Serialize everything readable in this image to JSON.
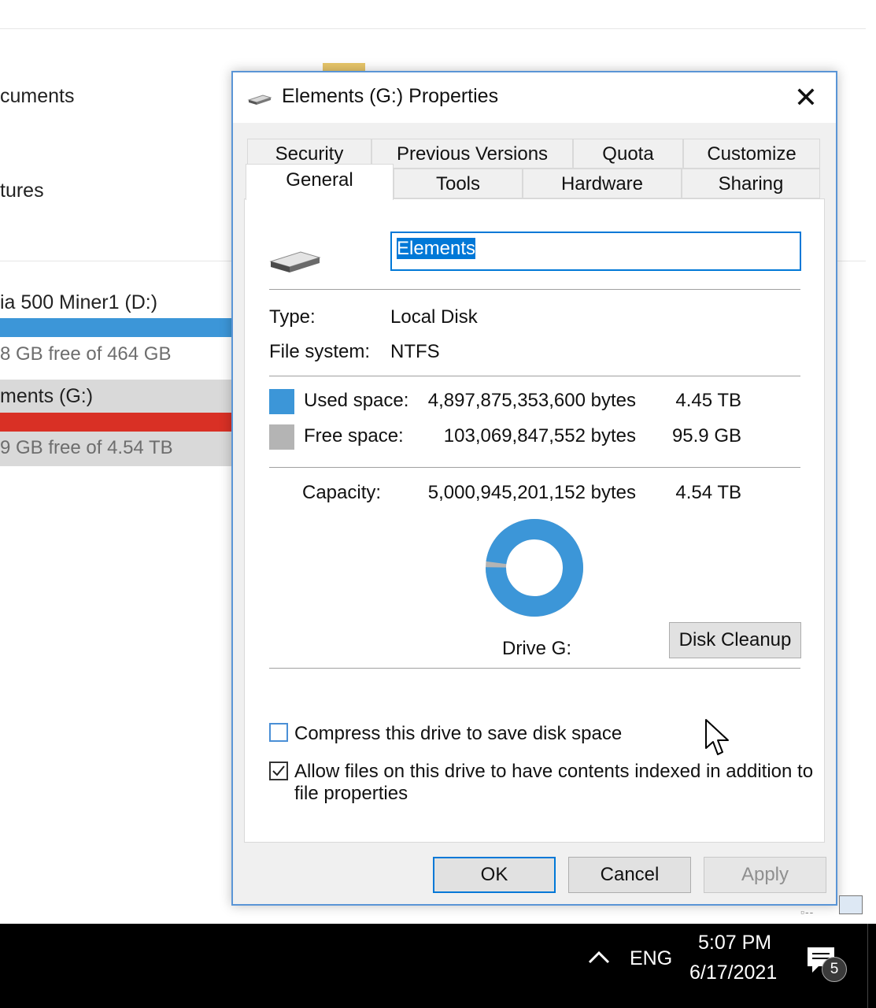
{
  "background": {
    "items": [
      "cuments",
      "tures"
    ],
    "drives": [
      {
        "name": "ia 500 Miner1 (D:)",
        "free": "8 GB free of 464 GB",
        "bar_color": "#3c96d8"
      },
      {
        "name": "ments (G:)",
        "free": "9 GB free of 4.54 TB",
        "bar_color": "#d93025"
      }
    ]
  },
  "dialog": {
    "title": "Elements (G:) Properties",
    "close_glyph": "✕",
    "tabs_row1": [
      "Security",
      "Previous Versions",
      "Quota",
      "Customize"
    ],
    "tabs_row2": [
      "General",
      "Tools",
      "Hardware",
      "Sharing"
    ],
    "active_tab": "General",
    "name_value": "Elements",
    "type_label": "Type:",
    "type_value": "Local Disk",
    "fs_label": "File system:",
    "fs_value": "NTFS",
    "used_label": "Used space:",
    "used_bytes": "4,897,875,353,600 bytes",
    "used_size": "4.45 TB",
    "used_color": "#3c96d8",
    "free_label": "Free space:",
    "free_bytes": "103,069,847,552 bytes",
    "free_size": "95.9 GB",
    "free_color": "#b4b4b4",
    "capacity_label": "Capacity:",
    "capacity_bytes": "5,000,945,201,152 bytes",
    "capacity_size": "4.54 TB",
    "used_fraction": 0.979,
    "drive_label": "Drive G:",
    "disk_cleanup_label": "Disk Cleanup",
    "compress_label": "Compress this drive to save disk space",
    "compress_checked": false,
    "index_label_line1": "Allow files on this drive to have contents indexed in addition to",
    "index_label_line2": "file properties",
    "index_checked": true,
    "ok_label": "OK",
    "cancel_label": "Cancel",
    "apply_label": "Apply"
  },
  "taskbar": {
    "lang": "ENG",
    "time": "5:07 PM",
    "date": "6/17/2021",
    "notification_count": "5"
  }
}
